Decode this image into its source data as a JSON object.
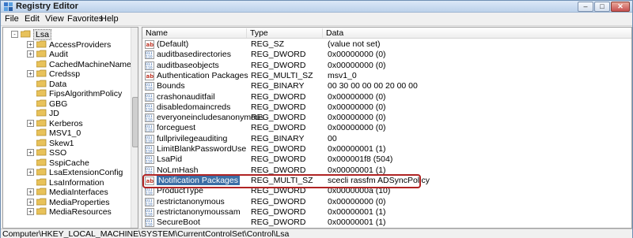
{
  "window": {
    "title": "Registry Editor",
    "app_icon": "registry-editor-icon"
  },
  "menu": [
    "File",
    "Edit",
    "View",
    "Favorites",
    "Help"
  ],
  "tree": [
    {
      "label": "Lsa",
      "expander": "-",
      "expanded": true
    },
    {
      "label": "AccessProviders",
      "expander": "+"
    },
    {
      "label": "Audit",
      "expander": "+"
    },
    {
      "label": "CachedMachineNames",
      "expander": ""
    },
    {
      "label": "Credssp",
      "expander": "+"
    },
    {
      "label": "Data",
      "expander": ""
    },
    {
      "label": "FipsAlgorithmPolicy",
      "expander": ""
    },
    {
      "label": "GBG",
      "expander": ""
    },
    {
      "label": "JD",
      "expander": ""
    },
    {
      "label": "Kerberos",
      "expander": "+"
    },
    {
      "label": "MSV1_0",
      "expander": ""
    },
    {
      "label": "Skew1",
      "expander": ""
    },
    {
      "label": "SSO",
      "expander": "+"
    },
    {
      "label": "SspiCache",
      "expander": ""
    },
    {
      "label": "LsaExtensionConfig",
      "expander": "+"
    },
    {
      "label": "LsaInformation",
      "expander": ""
    },
    {
      "label": "MediaInterfaces",
      "expander": "+"
    },
    {
      "label": "MediaProperties",
      "expander": "+"
    },
    {
      "label": "MediaResources",
      "expander": "+"
    }
  ],
  "columns": {
    "name": "Name",
    "type": "Type",
    "data": "Data"
  },
  "values": [
    {
      "icon": "ab",
      "name": "(Default)",
      "type": "REG_SZ",
      "data": "(value not set)"
    },
    {
      "icon": "bin",
      "name": "auditbasedirectories",
      "type": "REG_DWORD",
      "data": "0x00000000 (0)"
    },
    {
      "icon": "bin",
      "name": "auditbaseobjects",
      "type": "REG_DWORD",
      "data": "0x00000000 (0)"
    },
    {
      "icon": "ab",
      "name": "Authentication Packages",
      "type": "REG_MULTI_SZ",
      "data": "msv1_0"
    },
    {
      "icon": "bin",
      "name": "Bounds",
      "type": "REG_BINARY",
      "data": "00 30 00 00 00 20 00 00"
    },
    {
      "icon": "bin",
      "name": "crashonauditfail",
      "type": "REG_DWORD",
      "data": "0x00000000 (0)"
    },
    {
      "icon": "bin",
      "name": "disabledomaincreds",
      "type": "REG_DWORD",
      "data": "0x00000000 (0)"
    },
    {
      "icon": "bin",
      "name": "everyoneincludesanonymous",
      "type": "REG_DWORD",
      "data": "0x00000000 (0)"
    },
    {
      "icon": "bin",
      "name": "forceguest",
      "type": "REG_DWORD",
      "data": "0x00000000 (0)"
    },
    {
      "icon": "bin",
      "name": "fullprivilegeauditing",
      "type": "REG_BINARY",
      "data": "00"
    },
    {
      "icon": "bin",
      "name": "LimitBlankPasswordUse",
      "type": "REG_DWORD",
      "data": "0x00000001 (1)"
    },
    {
      "icon": "bin",
      "name": "LsaPid",
      "type": "REG_DWORD",
      "data": "0x000001f8 (504)"
    },
    {
      "icon": "bin",
      "name": "NoLmHash",
      "type": "REG_DWORD",
      "data": "0x00000001 (1)"
    },
    {
      "icon": "ab",
      "name": "Notification Packages",
      "type": "REG_MULTI_SZ",
      "data": "scecli rassfm ADSyncPolicy",
      "selected": true
    },
    {
      "icon": "bin",
      "name": "ProductType",
      "type": "REG_DWORD",
      "data": "0x0000000a (10)"
    },
    {
      "icon": "bin",
      "name": "restrictanonymous",
      "type": "REG_DWORD",
      "data": "0x00000000 (0)"
    },
    {
      "icon": "bin",
      "name": "restrictanonymoussam",
      "type": "REG_DWORD",
      "data": "0x00000001 (1)"
    },
    {
      "icon": "bin",
      "name": "SecureBoot",
      "type": "REG_DWORD",
      "data": "0x00000001 (1)"
    }
  ],
  "status": {
    "path": "Computer\\HKEY_LOCAL_MACHINE\\SYSTEM\\CurrentControlSet\\Control\\Lsa"
  },
  "colors": {
    "selection": "#3b6ea5",
    "callout": "#b02424",
    "folder": "#e8c25a"
  }
}
